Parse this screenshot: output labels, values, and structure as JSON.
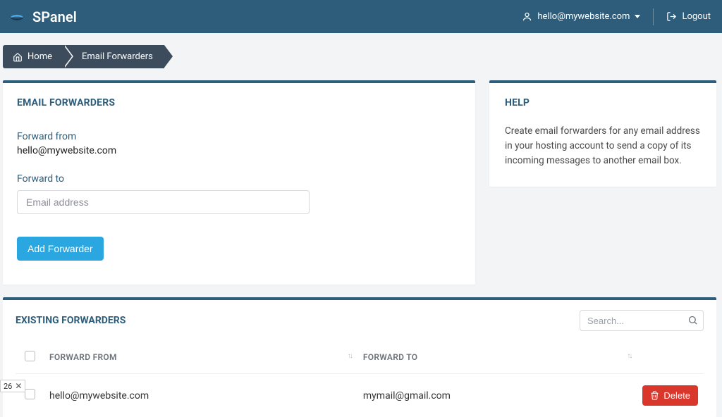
{
  "brand": {
    "name": "SPanel"
  },
  "header": {
    "account_email": "hello@mywebsite.com",
    "logout_label": "Logout"
  },
  "breadcrumb": {
    "home": "Home",
    "current": "Email Forwarders"
  },
  "main_card": {
    "title": "EMAIL FORWARDERS",
    "forward_from_label": "Forward from",
    "forward_from_value": "hello@mywebsite.com",
    "forward_to_label": "Forward to",
    "forward_to_placeholder": "Email address",
    "add_button": "Add Forwarder"
  },
  "help_card": {
    "title": "HELP",
    "body": "Create email forwarders for any email address in your hosting account to send a copy of its incoming messages to another email box."
  },
  "table_card": {
    "title": "EXISTING FORWARDERS",
    "search_placeholder": "Search...",
    "col_from": "FORWARD FROM",
    "col_to": "FORWARD TO",
    "delete_label": "Delete",
    "rows": [
      {
        "from": "hello@mywebsite.com",
        "to": "mymail@gmail.com"
      }
    ]
  },
  "status_chip": {
    "value": "26"
  }
}
